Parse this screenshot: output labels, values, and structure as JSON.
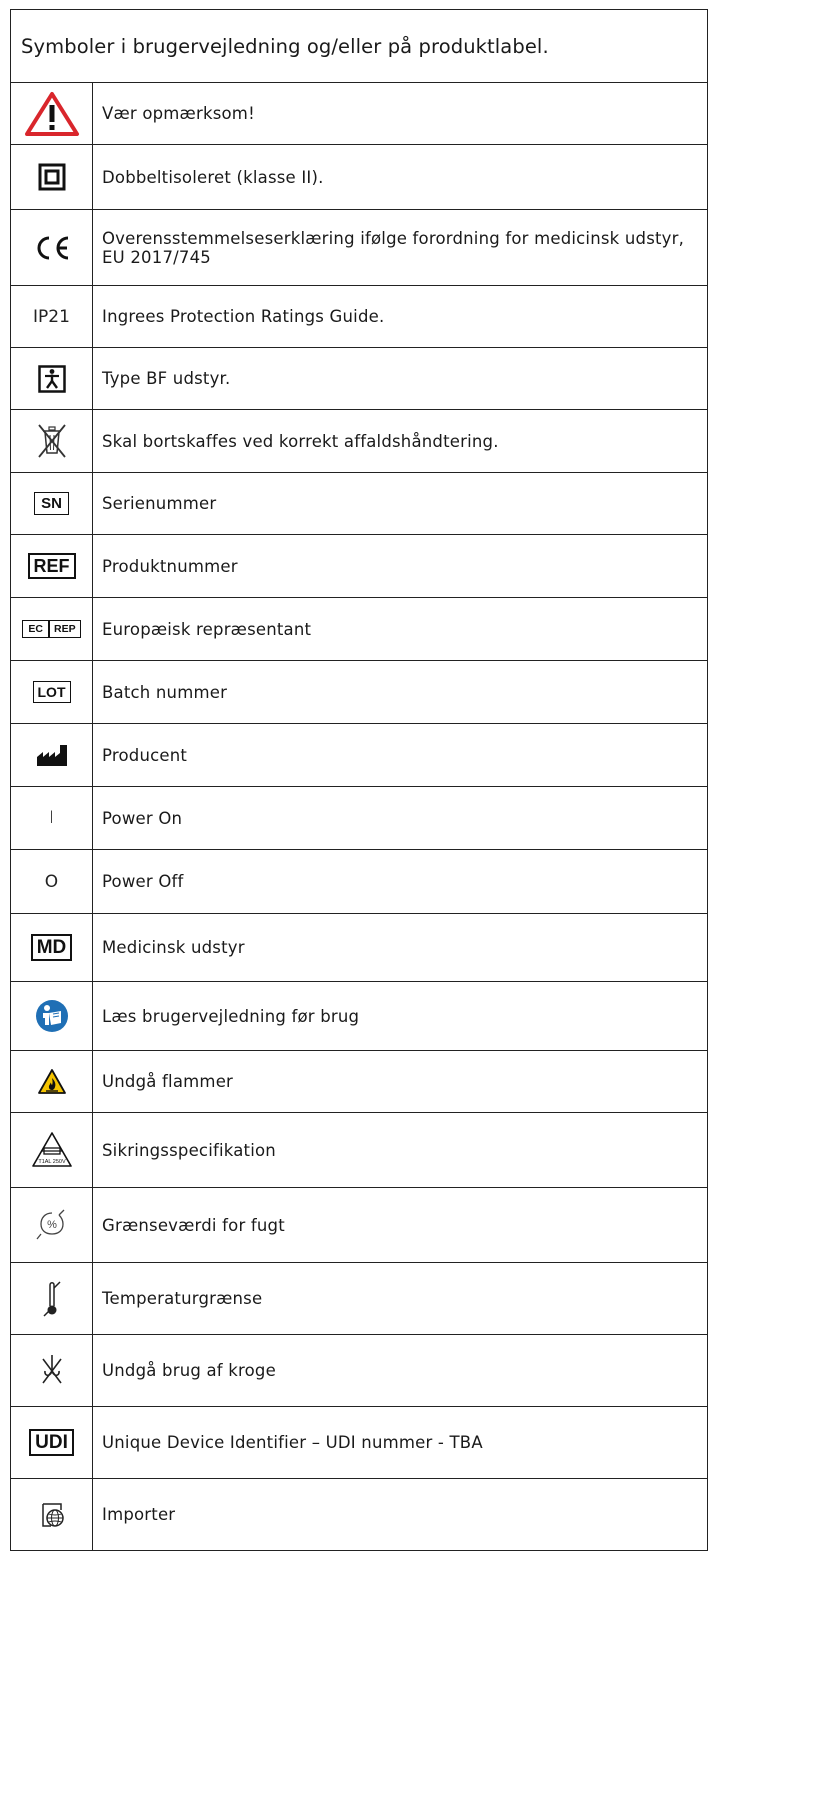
{
  "table": {
    "header": "Symboler i brugervejledning og/eller på produktlabel.",
    "rows": [
      {
        "symbol": "warning-triangle-icon",
        "description": "Vær opmærksom!"
      },
      {
        "symbol": "double-insulation-icon",
        "description": "Dobbeltisoleret (klasse II)."
      },
      {
        "symbol": "ce-mark-icon",
        "description": "Overensstemmelseserklæring ifølge forordning for medicinsk udstyr, EU 2017/745"
      },
      {
        "symbol_text": "IP21",
        "description": "Ingrees Protection Ratings Guide."
      },
      {
        "symbol": "type-bf-icon",
        "description": "Type BF udstyr."
      },
      {
        "symbol": "crossed-bin-icon",
        "description": "Skal bortskaffes ved korrekt affaldshåndtering."
      },
      {
        "symbol_text": "SN",
        "description": "Serienummer"
      },
      {
        "symbol_text": "REF",
        "description": "Produktnummer"
      },
      {
        "symbol_text_a": "EC",
        "symbol_text_b": "REP",
        "description": "Europæisk repræsentant"
      },
      {
        "symbol_text": "LOT",
        "description": "Batch nummer"
      },
      {
        "symbol": "manufacturer-icon",
        "description": "Producent"
      },
      {
        "symbol_text": "I",
        "description": "Power On"
      },
      {
        "symbol_text": "O",
        "description": "Power Off"
      },
      {
        "symbol_text": "MD",
        "description": "Medicinsk udstyr"
      },
      {
        "symbol": "read-manual-icon",
        "description": "Læs brugervejledning før brug"
      },
      {
        "symbol": "flame-warning-icon",
        "description": "Undgå flammer"
      },
      {
        "symbol": "fuse-icon",
        "symbol_text": "T1AL 250V",
        "description": "Sikringsspecifikation"
      },
      {
        "symbol": "humidity-limit-icon",
        "symbol_text": "%",
        "description": "Grænseværdi for fugt"
      },
      {
        "symbol": "temperature-limit-icon",
        "description": "Temperaturgrænse"
      },
      {
        "symbol": "no-hooks-icon",
        "description": "Undgå brug af kroge"
      },
      {
        "symbol_text": "UDI",
        "description": "Unique Device Identifier – UDI nummer - TBA"
      },
      {
        "symbol": "importer-icon",
        "description": "Importer"
      }
    ]
  },
  "colors": {
    "border": "#222222",
    "warning_red": "#d9262c",
    "manual_blue": "#1f6fb5",
    "flame_yellow": "#f5c400"
  }
}
